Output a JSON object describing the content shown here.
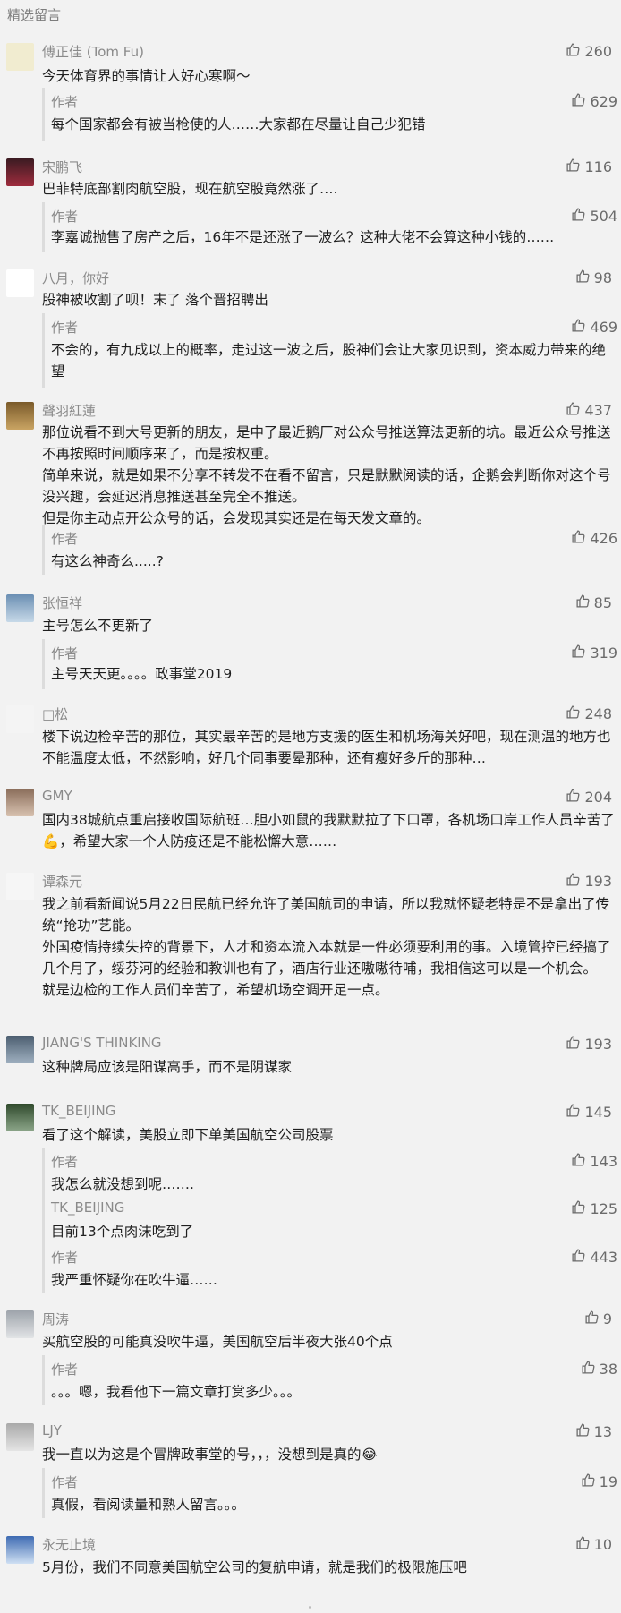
{
  "section_title": "精选留言",
  "colors": {
    "accent": "#576b95",
    "text": "#1f1f1f",
    "muted": "#8a8a8a",
    "bg": "#f2f2f2"
  },
  "comments": [
    {
      "nick": "傅正佳 (Tom Fu)",
      "likes": "260",
      "text": "今天体育界的事情让人好心寒啊～",
      "replies": [
        {
          "nick": "作者",
          "likes": "629",
          "text": "每个国家都会有被当枪使的人……大家都在尽量让自己少犯错"
        }
      ]
    },
    {
      "nick": "宋鹏飞",
      "likes": "116",
      "text": "巴菲特底部割肉航空股，现在航空股竟然涨了….",
      "replies": [
        {
          "nick": "作者",
          "likes": "504",
          "text": "李嘉诚抛售了房产之后，16年不是还涨了一波么？这种大佬不会算这种小钱的……"
        }
      ]
    },
    {
      "nick": "八月，你好",
      "likes": "98",
      "text": "股神被收割了呗！末了 落个晋招聘出",
      "replies": [
        {
          "nick": "作者",
          "likes": "469",
          "text": "不会的，有九成以上的概率，走过这一波之后，股神们会让大家见识到，资本威力带来的绝望"
        }
      ]
    },
    {
      "nick": "聲羽紅蓮",
      "likes": "437",
      "text": "那位说看不到大号更新的朋友，是中了最近鹅厂对公众号推送算法更新的坑。最近公众号推送不再按照时间顺序来了，而是按权重。\n简单来说，就是如果不分享不转发不在看不留言，只是默默阅读的话，企鹅会判断你对这个号没兴趣，会延迟消息推送甚至完全不推送。\n但是你主动点开公众号的话，会发现其实还是在每天发文章的。",
      "replies": [
        {
          "nick": "作者",
          "likes": "426",
          "text": "有这么神奇么.....?"
        }
      ]
    },
    {
      "nick": "张恒祥",
      "likes": "85",
      "text": "主号怎么不更新了",
      "replies": [
        {
          "nick": "作者",
          "likes": "319",
          "text": "主号天天更。。。。政事堂2019"
        }
      ]
    },
    {
      "nick": "□松",
      "likes": "248",
      "text": "楼下说边检辛苦的那位，其实最辛苦的是地方支援的医生和机场海关好吧，现在测温的地方也不能温度太低，不然影响，好几个同事要晕那种，还有瘦好多斤的那种…",
      "replies": []
    },
    {
      "nick": "GMY",
      "likes": "204",
      "text": "国内38城航点重启接收国际航班…胆小如鼠的我默默拉了下口罩，各机场口岸工作人员辛苦了💪，希望大家一个人防疫还是不能松懈大意……",
      "replies": []
    },
    {
      "nick": "谭森元",
      "likes": "193",
      "text": "我之前看新闻说5月22日民航已经允许了美国航司的申请，所以我就怀疑老特是不是拿出了传统“抢功”艺能。\n外国疫情持续失控的背景下，人才和资本流入本就是一件必须要利用的事。入境管控已经搞了几个月了，绥芬河的经验和教训也有了，酒店行业还嗷嗷待哺，我相信这可以是一个机会。\n就是边检的工作人员们辛苦了，希望机场空调开足一点。",
      "replies": []
    },
    {
      "nick": "JIANG'S THINKING",
      "likes": "193",
      "text": "这种牌局应该是阳谋高手，而不是阴谋家",
      "replies": []
    },
    {
      "nick": "TK_BEIJING",
      "likes": "145",
      "text": "看了这个解读，美股立即下单美国航空公司股票",
      "replies": [
        {
          "nick": "作者",
          "likes": "143",
          "text": "我怎么就没想到呢……."
        },
        {
          "nick": "TK_BEIJING",
          "likes": "125",
          "text": "目前13个点肉沫吃到了"
        },
        {
          "nick": "作者",
          "likes": "443",
          "text": "我严重怀疑你在吹牛逼……"
        }
      ]
    },
    {
      "nick": "周涛",
      "likes": "9",
      "text": "买航空股的可能真没吹牛逼，美国航空后半夜大张40个点",
      "replies": [
        {
          "nick": "作者",
          "likes": "38",
          "text": "。。。嗯，我看他下一篇文章打赏多少。。。"
        }
      ]
    },
    {
      "nick": "LJY",
      "likes": "13",
      "text": "我一直以为这是个冒牌政事堂的号，，，没想到是真的😂",
      "replies": [
        {
          "nick": "作者",
          "likes": "19",
          "text": "真假，看阅读量和熟人留言。。。"
        }
      ]
    },
    {
      "nick": "永无止境",
      "likes": "10",
      "text": "5月份，我们不同意美国航空公司的复航申请，就是我们的极限施压吧",
      "replies": []
    }
  ]
}
